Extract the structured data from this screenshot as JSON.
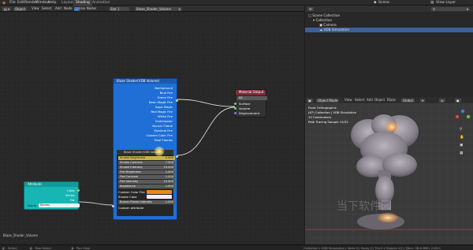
{
  "topbar": {
    "menus": [
      "File",
      "Edit",
      "Render",
      "Window",
      "Help"
    ],
    "tabs": [
      "Layout",
      "Shading",
      "Animation"
    ],
    "active_tab": "Shading",
    "scene_label": "Scene",
    "view_layer_label": "View Layer"
  },
  "node_header": {
    "editor_type": "Object",
    "menus": [
      "View",
      "Select",
      "Add",
      "Node"
    ],
    "use_nodes_label": "Use Nodes",
    "slot_label": "Slot 1",
    "material_name": "Blaze_Shader_Volume"
  },
  "shader_node": {
    "title": "Blaze Shader(VDB Volume)",
    "outputs": [
      "Background",
      "Blue Fire",
      "Green Fire",
      "Neon Magic Fire",
      "Aqua Magic",
      "Red Magic Fire",
      "White Fire",
      "Underwater",
      "Burner Flame",
      "Mystical Fire",
      "Custom Color Fire",
      "Real Flames"
    ],
    "group_title": "Blaze Shader(VDB Volume)",
    "params": [
      {
        "label": "Smoke Brightness",
        "value": "0.000"
      },
      {
        "label": "Smoke Contrast",
        "value": "7.000"
      },
      {
        "label": "Smoke Intensity",
        "value": "10.000"
      },
      {
        "label": "Fire Brightness",
        "value": "1.000"
      },
      {
        "label": "Fire Contrast",
        "value": "1.000"
      },
      {
        "label": "Fire Intensity",
        "value": "10.000"
      },
      {
        "label": "Impedance",
        "value": "1.000"
      }
    ],
    "custom_color_fire_label": "Custom Color Fire",
    "smoke_color_label": "Smoke Color",
    "burner_intensity": {
      "label": "Burner Flame Intensity",
      "value": "1.000"
    },
    "custom_attribute_label": "Custom attribute"
  },
  "attribute_node": {
    "title": "Attribute",
    "outputs": [
      "Color",
      "Vector",
      "Fac"
    ],
    "name_label": "Name",
    "name_value": "flames"
  },
  "output_node": {
    "title": "Material Output",
    "target": "All",
    "inputs": [
      "Surface",
      "Volume",
      "Displacement"
    ]
  },
  "node_footer_label": "Blaze_Shader_Volume",
  "outliner": {
    "rows": [
      {
        "label": "Scene Collection",
        "indent": 0
      },
      {
        "label": "Collection",
        "indent": 1
      },
      {
        "label": "Camera",
        "indent": 2
      },
      {
        "label": "VDB Simulation",
        "indent": 2
      }
    ],
    "selected_row": "VDB Simulation"
  },
  "viewport": {
    "mode_label": "Object Mode",
    "menus": [
      "View",
      "Select",
      "Add",
      "Object",
      "Blaze"
    ],
    "overlay_lines": [
      "Front Orthographic",
      "(67) Collection | VDB Simulation",
      "10 Centimeters",
      "Path Tracing Sample 15/32"
    ],
    "orientation_label": "Global"
  },
  "watermark": "当下软件园",
  "statusbar": {
    "left_items": [
      "Select",
      "Box Select",
      "Pan View"
    ],
    "right_text": "Collection | VDB Simulation | Verts 0 | Faces 0 | Tris 0 | Objects 1/2 | Mem: 38.6 MiB | 2.83.0"
  },
  "colors": {
    "shader_node": "#1f6fd6",
    "attribute_node": "#18b5b5",
    "output_header": "#8a2b39",
    "selection": "#3e5f9a"
  }
}
